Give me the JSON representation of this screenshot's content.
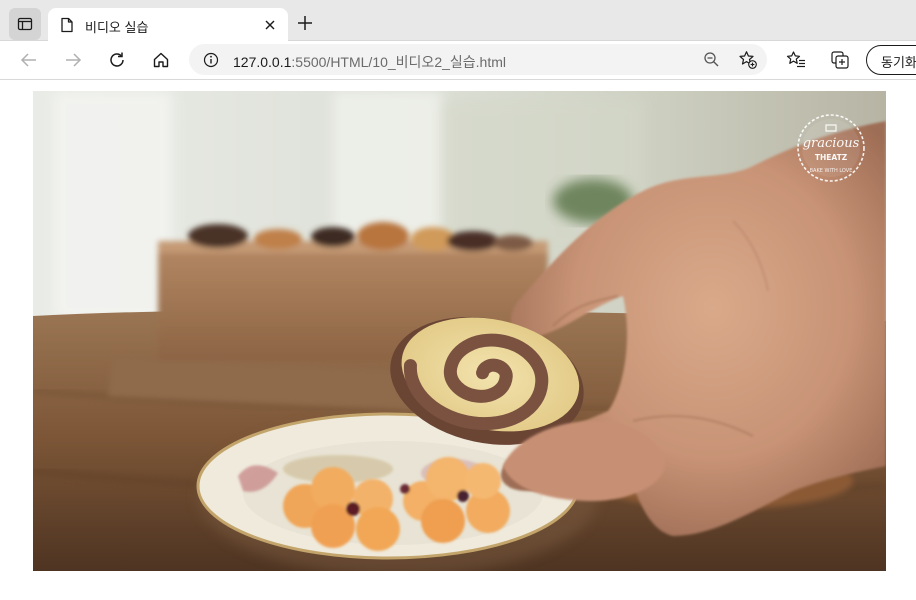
{
  "tab": {
    "title": "비디오 실습"
  },
  "address_bar": {
    "url_host": "127.0.0.1",
    "url_path": ":5500/HTML/10_비디오2_실습.html"
  },
  "toolbar": {
    "sync_label": "동기화"
  },
  "video": {
    "watermark_lines": [
      "gracious",
      "THEATZ",
      "BAKE WITH LOVE"
    ]
  },
  "colors": {
    "tabstrip_bg": "#e8e8e8",
    "omnibox_bg": "#f3f3f3",
    "icon": "#1b1b1b",
    "disabled_icon": "#b0b0b0"
  }
}
